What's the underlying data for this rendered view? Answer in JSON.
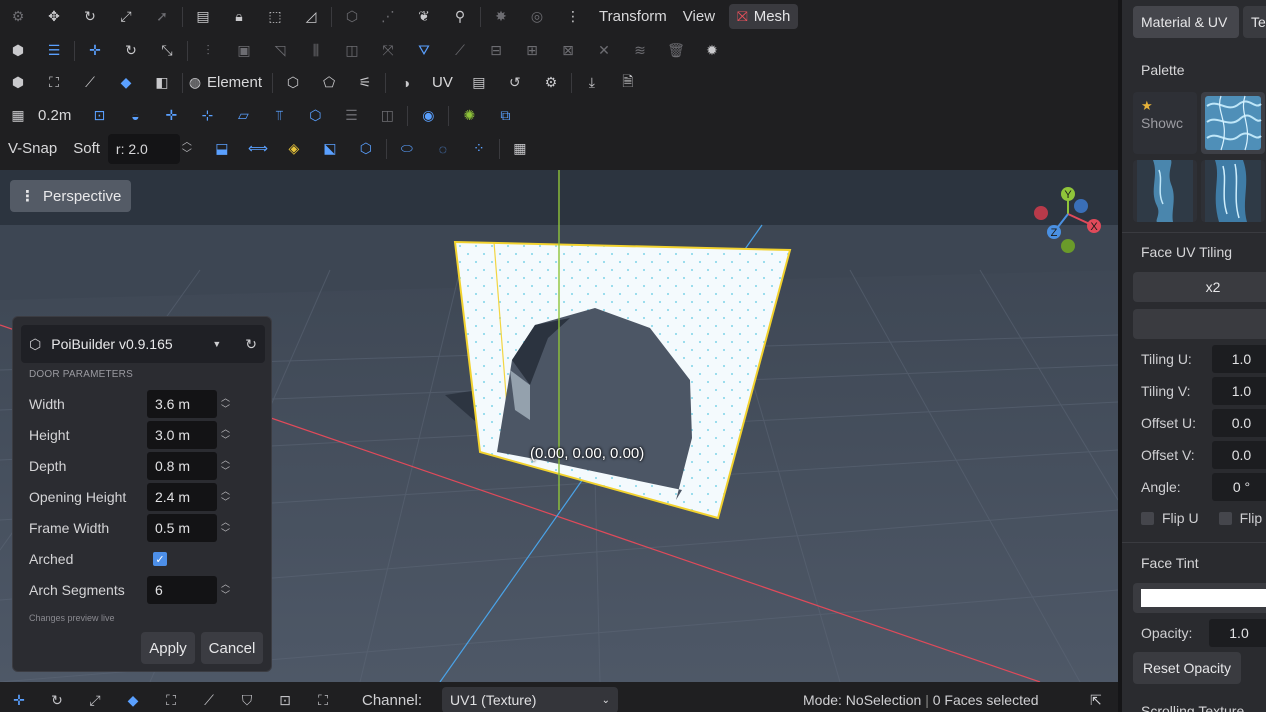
{
  "toolbar_row1": {
    "menus": [
      "Transform",
      "View"
    ],
    "mesh_menu_label": "Mesh"
  },
  "toolbar_row3": {
    "element_label": "Element",
    "uv_label": "UV"
  },
  "toolbar_row4": {
    "grid_size": "0.2m"
  },
  "toolbar_row5": {
    "vsnap_label": "V-Snap",
    "soft_label": "Soft",
    "radius_value": "r: 2.0"
  },
  "viewport": {
    "view_label": "Perspective",
    "coordinate_readout": "(0.00, 0.00, 0.00)",
    "gizmo": {
      "y": "Y",
      "x": "X",
      "z": "Z"
    }
  },
  "poi_panel": {
    "title": "PoiBuilder v0.9.165",
    "section": "DOOR PARAMETERS",
    "params": [
      {
        "label": "Width",
        "value": "3.6 m"
      },
      {
        "label": "Height",
        "value": "3.0 m"
      },
      {
        "label": "Depth",
        "value": "0.8 m"
      },
      {
        "label": "Opening Height",
        "value": "2.4 m"
      },
      {
        "label": "Frame Width",
        "value": "0.5 m"
      }
    ],
    "arched_label": "Arched",
    "arched_checked": true,
    "arch_segments_label": "Arch Segments",
    "arch_segments_value": "6",
    "note": "Changes preview live",
    "apply_label": "Apply",
    "cancel_label": "Cancel"
  },
  "statusbar": {
    "channel_label": "Channel:",
    "channel_value": "UV1 (Texture)",
    "mode_text": "Mode: NoSelection",
    "faces_text": "0 Faces selected"
  },
  "right_panel": {
    "tab_material": "Material & UV",
    "tab_next": "Te",
    "palette_label": "Palette",
    "showcase_label": "Showc",
    "face_uv_tiling_label": "Face UV Tiling",
    "tiling_button": "x2",
    "fields": [
      {
        "label": "Tiling U:",
        "value": "1.0"
      },
      {
        "label": "Tiling V:",
        "value": "1.0"
      },
      {
        "label": "Offset U:",
        "value": "0.0"
      },
      {
        "label": "Offset V:",
        "value": "0.0"
      },
      {
        "label": "Angle:",
        "value": "0 °"
      }
    ],
    "flip_u_label": "Flip U",
    "flip_v_label": "Flip",
    "face_tint_label": "Face Tint",
    "tint_color": "#ffffff",
    "opacity_label": "Opacity:",
    "opacity_value": "1.0",
    "reset_opacity_label": "Reset Opacity",
    "bottom_cut_label": "Scrolling Texture"
  },
  "colors": {
    "accent_blue": "#4d8fe8",
    "mesh_icon_red": "#e8505b",
    "selection_yellow": "#f2d22e",
    "axis_x_red": "#e04a5a",
    "axis_y_green": "#8fc43a",
    "axis_z_blue": "#4a90e2"
  }
}
